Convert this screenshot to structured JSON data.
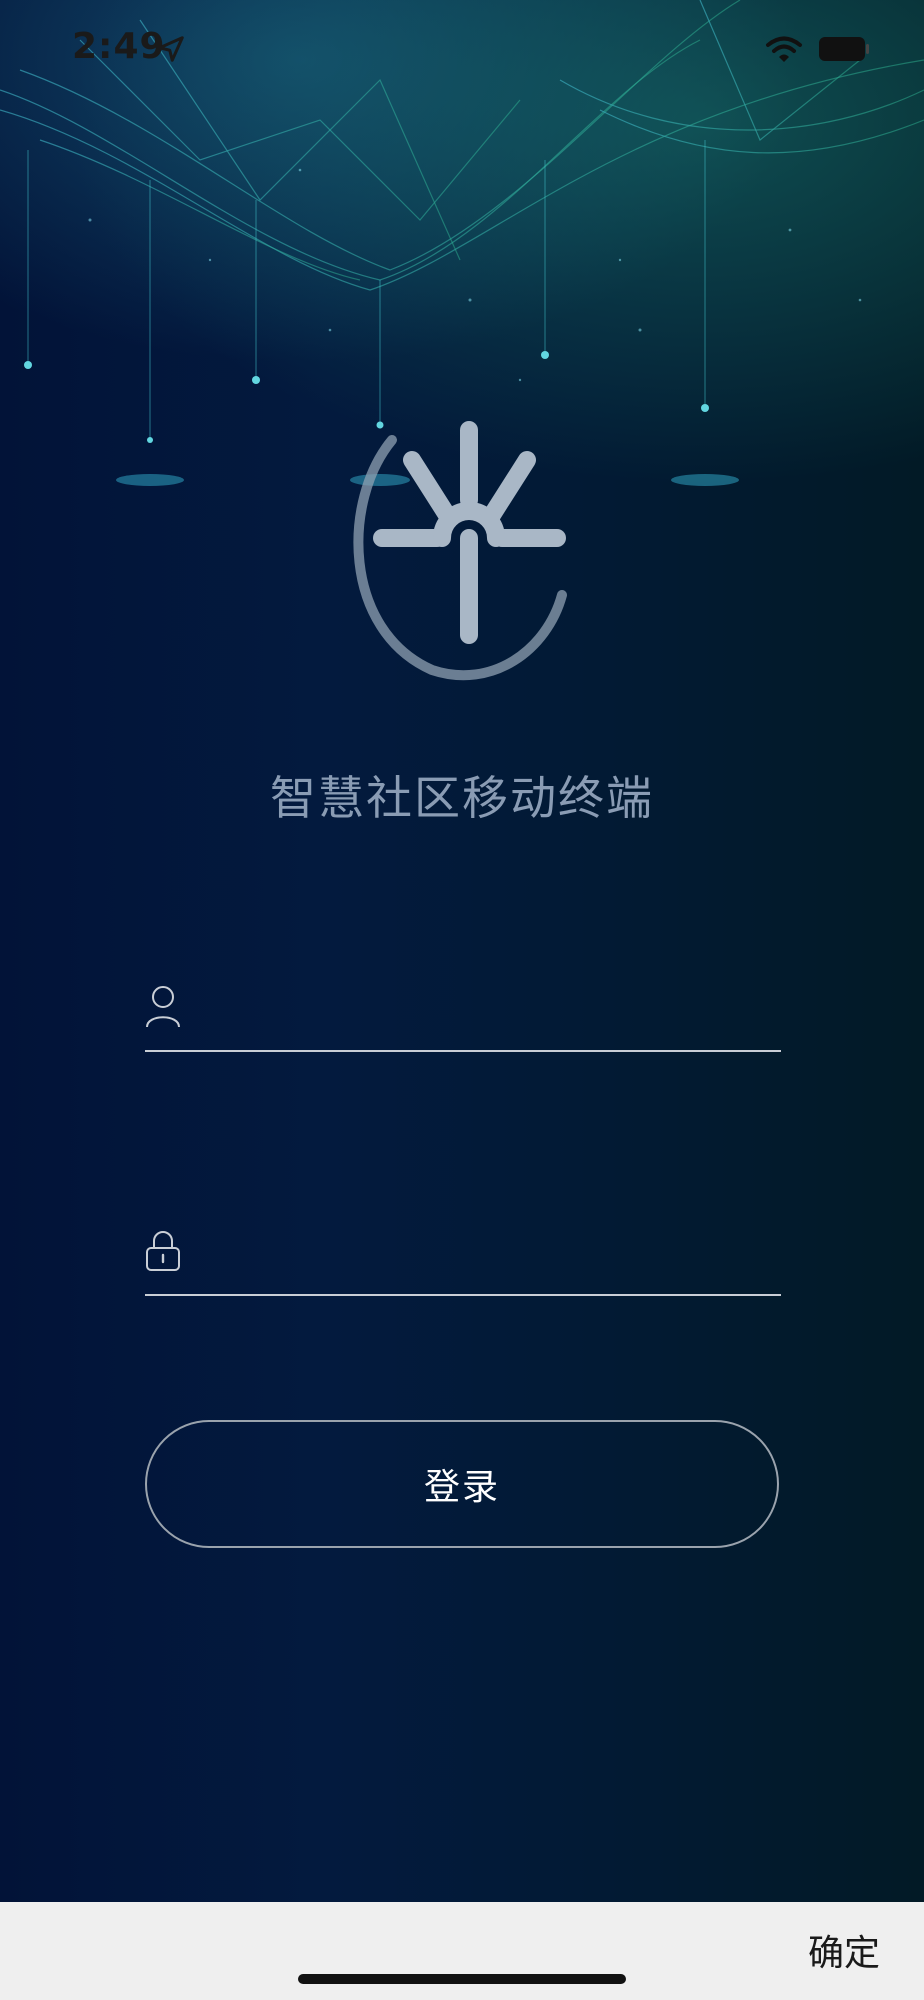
{
  "status_bar": {
    "time": "2:49"
  },
  "app": {
    "title": "智慧社区移动终端"
  },
  "login_form": {
    "username_field": {
      "value": "",
      "placeholder": ""
    },
    "password_field": {
      "value": "",
      "placeholder": ""
    },
    "login_label": "登录"
  },
  "toolbar": {
    "confirm_label": "确定"
  },
  "icons": {
    "location": "location-arrow-icon",
    "wifi": "wifi-icon",
    "battery": "battery-icon",
    "logo": "app-logo",
    "username": "user-icon",
    "password": "lock-icon"
  },
  "colors": {
    "background_dark": "#021338",
    "title_text": "#8a9cb4",
    "field_line": "#c9ced6",
    "button_border": "#9aa3ad",
    "toolbar_bg": "#efefef"
  }
}
